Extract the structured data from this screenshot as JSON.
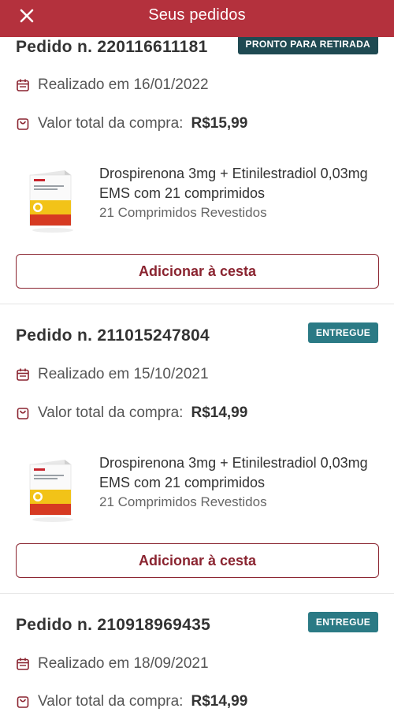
{
  "header": {
    "title": "Seus pedidos",
    "close_icon": "close-icon"
  },
  "colors": {
    "header": "#b4313d",
    "accent": "#8a2430",
    "badge_ready": "#1f4a52",
    "badge_delivered": "#2b7a85"
  },
  "orders": [
    {
      "number": "Pedido n. 220116611181",
      "status": "PRONTO PARA RETIRADA",
      "date": "Realizado em 16/01/2022",
      "total_label": "Valor total da compra:",
      "total_value": "R$15,99",
      "product_name": "Drospirenona 3mg + Etinilestradiol 0,03mg EMS com 21 comprimidos",
      "product_desc": "21 Comprimidos Revestidos",
      "button": "Adicionar à cesta"
    },
    {
      "number": "Pedido n. 211015247804",
      "status": "ENTREGUE",
      "date": "Realizado em 15/10/2021",
      "total_label": "Valor total da compra:",
      "total_value": "R$14,99",
      "product_name": "Drospirenona 3mg + Etinilestradiol 0,03mg EMS com 21 comprimidos",
      "product_desc": "21 Comprimidos Revestidos",
      "button": "Adicionar à cesta"
    },
    {
      "number": "Pedido n. 210918969435",
      "status": "ENTREGUE",
      "date": "Realizado em 18/09/2021",
      "total_label": "Valor total da compra:",
      "total_value": "R$14,99"
    }
  ]
}
